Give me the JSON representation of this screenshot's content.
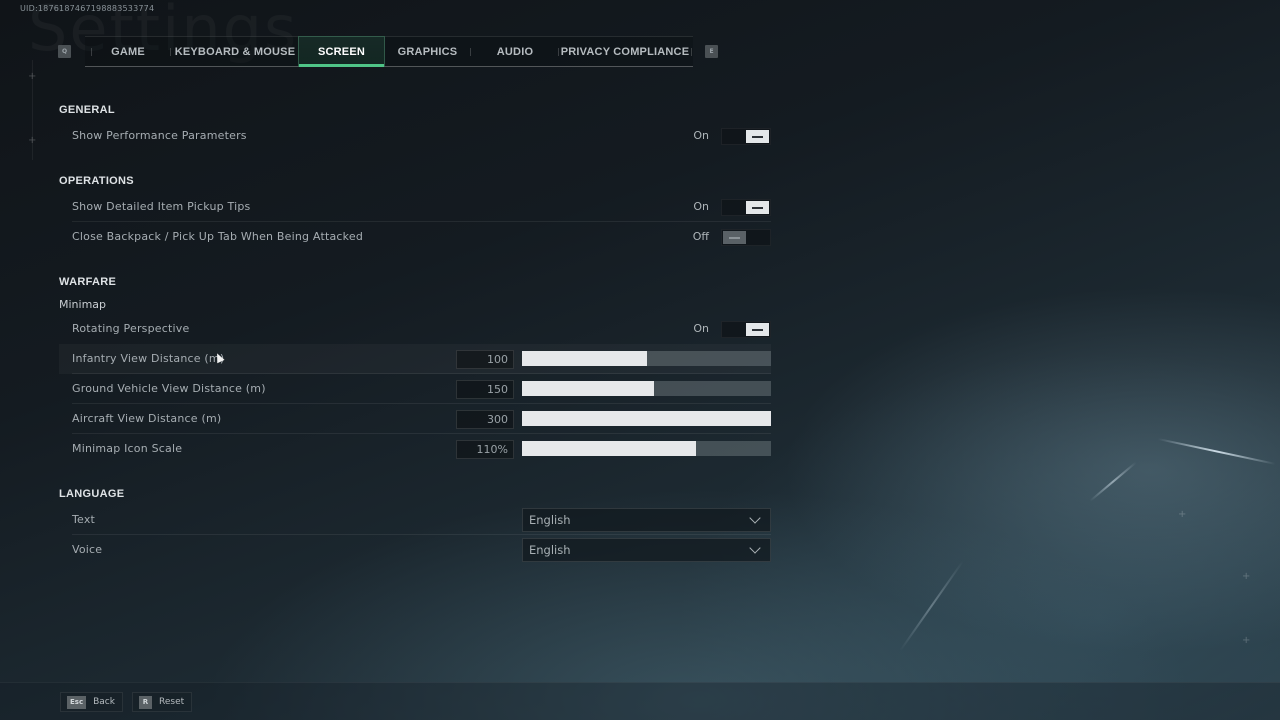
{
  "uid": "UID:1876187467198883533774",
  "watermark": "Settings",
  "tabs": {
    "prev_key": "Q",
    "next_key": "E",
    "items": [
      {
        "label": "GAME",
        "active": false
      },
      {
        "label": "KEYBOARD & MOUSE",
        "active": false
      },
      {
        "label": "SCREEN",
        "active": true
      },
      {
        "label": "GRAPHICS",
        "active": false
      },
      {
        "label": "AUDIO",
        "active": false
      },
      {
        "label": "PRIVACY COMPLIANCE",
        "active": false
      }
    ]
  },
  "sections": {
    "general": {
      "title": "GENERAL",
      "show_performance": {
        "label": "Show Performance Parameters",
        "state": "On",
        "on": true
      }
    },
    "operations": {
      "title": "OPERATIONS",
      "pickup_tips": {
        "label": "Show Detailed Item Pickup Tips",
        "state": "On",
        "on": true
      },
      "close_backpack": {
        "label": "Close Backpack / Pick Up Tab When Being Attacked",
        "state": "Off",
        "on": false
      }
    },
    "warfare": {
      "title": "WARFARE",
      "subgroup": "Minimap",
      "rotating": {
        "label": "Rotating Perspective",
        "state": "On",
        "on": true
      },
      "infantry": {
        "label": "Infantry View Distance (m)",
        "value": "100",
        "fill_fraction": 0.5
      },
      "ground_vehicle": {
        "label": "Ground Vehicle View Distance (m)",
        "value": "150",
        "fill_fraction": 0.53
      },
      "aircraft": {
        "label": "Aircraft View Distance (m)",
        "value": "300",
        "fill_fraction": 1.0
      },
      "icon_scale": {
        "label": "Minimap Icon Scale",
        "value": "110%",
        "fill_fraction": 0.7
      }
    },
    "language": {
      "title": "LANGUAGE",
      "text": {
        "label": "Text",
        "value": "English"
      },
      "voice": {
        "label": "Voice",
        "value": "English"
      }
    }
  },
  "footer": {
    "back": {
      "key": "Esc",
      "label": "Back"
    },
    "reset": {
      "key": "R",
      "label": "Reset"
    }
  },
  "colors": {
    "accent": "#4fc587",
    "toggle_on": "#e4e7e9",
    "slider_fill": "#e6e8ea"
  }
}
